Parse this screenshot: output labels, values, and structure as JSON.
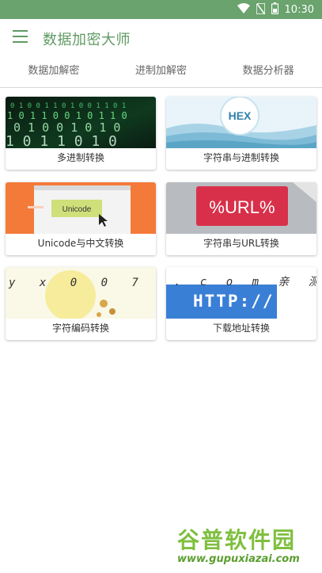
{
  "status_bar": {
    "time": "10:30",
    "icons": [
      "wifi-icon",
      "no-sim-icon",
      "battery-icon"
    ]
  },
  "app_bar": {
    "title": "数据加密大师",
    "menu_icon": "menu-icon"
  },
  "tabs": [
    {
      "label": "数据加解密"
    },
    {
      "label": "进制加解密"
    },
    {
      "label": "数据分析器"
    }
  ],
  "cards": [
    {
      "label": "多进制转换",
      "thumb_text": "101001011010"
    },
    {
      "label": "字符串与进制转换",
      "thumb_text": "HEX"
    },
    {
      "label": "Unicode与中文转换",
      "thumb_text": "Unicode"
    },
    {
      "label": "字符串与URL转换",
      "thumb_text": "%URL%"
    },
    {
      "label": "字符编码转换",
      "thumb_text": "y x 0 0 7 ."
    },
    {
      "label": "下载地址转换",
      "thumb_text_top": ". c o m 亲 测",
      "thumb_text": "HTTP://"
    }
  ],
  "watermark": {
    "main": "谷普软件园",
    "url": "www.gupuxiazai.com"
  },
  "colors": {
    "accent": "#5f9a63",
    "status_bar": "#6aa36d"
  }
}
